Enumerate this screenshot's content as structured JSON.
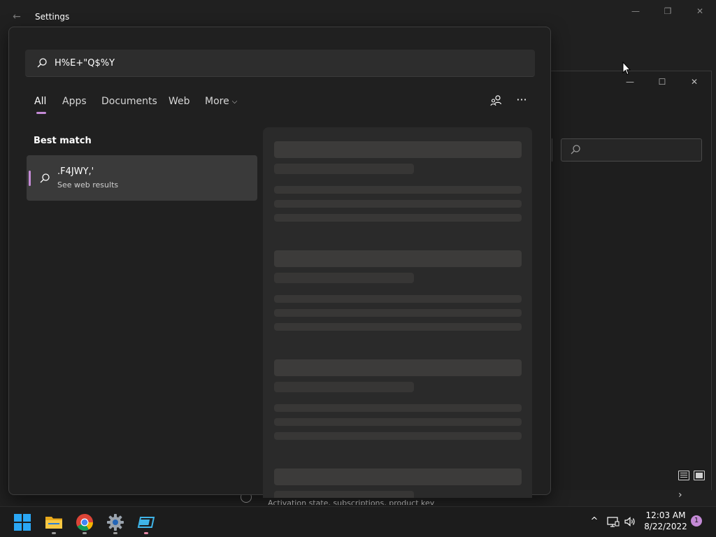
{
  "settings_window": {
    "title": "Settings",
    "back_glyph": "←",
    "minimize_glyph": "—",
    "restore_glyph": "❐",
    "close_glyph": "✕"
  },
  "second_window": {
    "minimize_glyph": "—",
    "maximize_glyph": "☐",
    "close_glyph": "✕",
    "search_icon": "search-icon",
    "peek_text": "Activation state, subscriptions, product key",
    "chevron_glyph": "›"
  },
  "search": {
    "query": "H%E+\"Q$%Y",
    "icon": "search-icon",
    "tabs": [
      {
        "label": "All",
        "active": true
      },
      {
        "label": "Apps",
        "active": false
      },
      {
        "label": "Documents",
        "active": false
      },
      {
        "label": "Web",
        "active": false
      },
      {
        "label": "More",
        "active": false
      }
    ],
    "more_chevron": "⌵",
    "more_options_glyph": "···",
    "people_icon": "people-icon",
    "best_match_label": "Best match",
    "result": {
      "title": ".F4JWY,'",
      "subtitle": "See web results",
      "icon": "search-icon"
    }
  },
  "taskbar": {
    "apps": [
      {
        "name": "start-icon"
      },
      {
        "name": "file-explorer-icon"
      },
      {
        "name": "chrome-icon"
      },
      {
        "name": "settings-icon"
      },
      {
        "name": "virtual-machine-icon"
      }
    ],
    "tray_chevron": "^",
    "clock_time": "12:03 AM",
    "clock_date": "8/22/2022",
    "notification_count": "1"
  },
  "colors": {
    "accent": "#c48ad6",
    "background": "#202020",
    "surface": "#2d2d2d",
    "selected": "#3a3a3a"
  }
}
